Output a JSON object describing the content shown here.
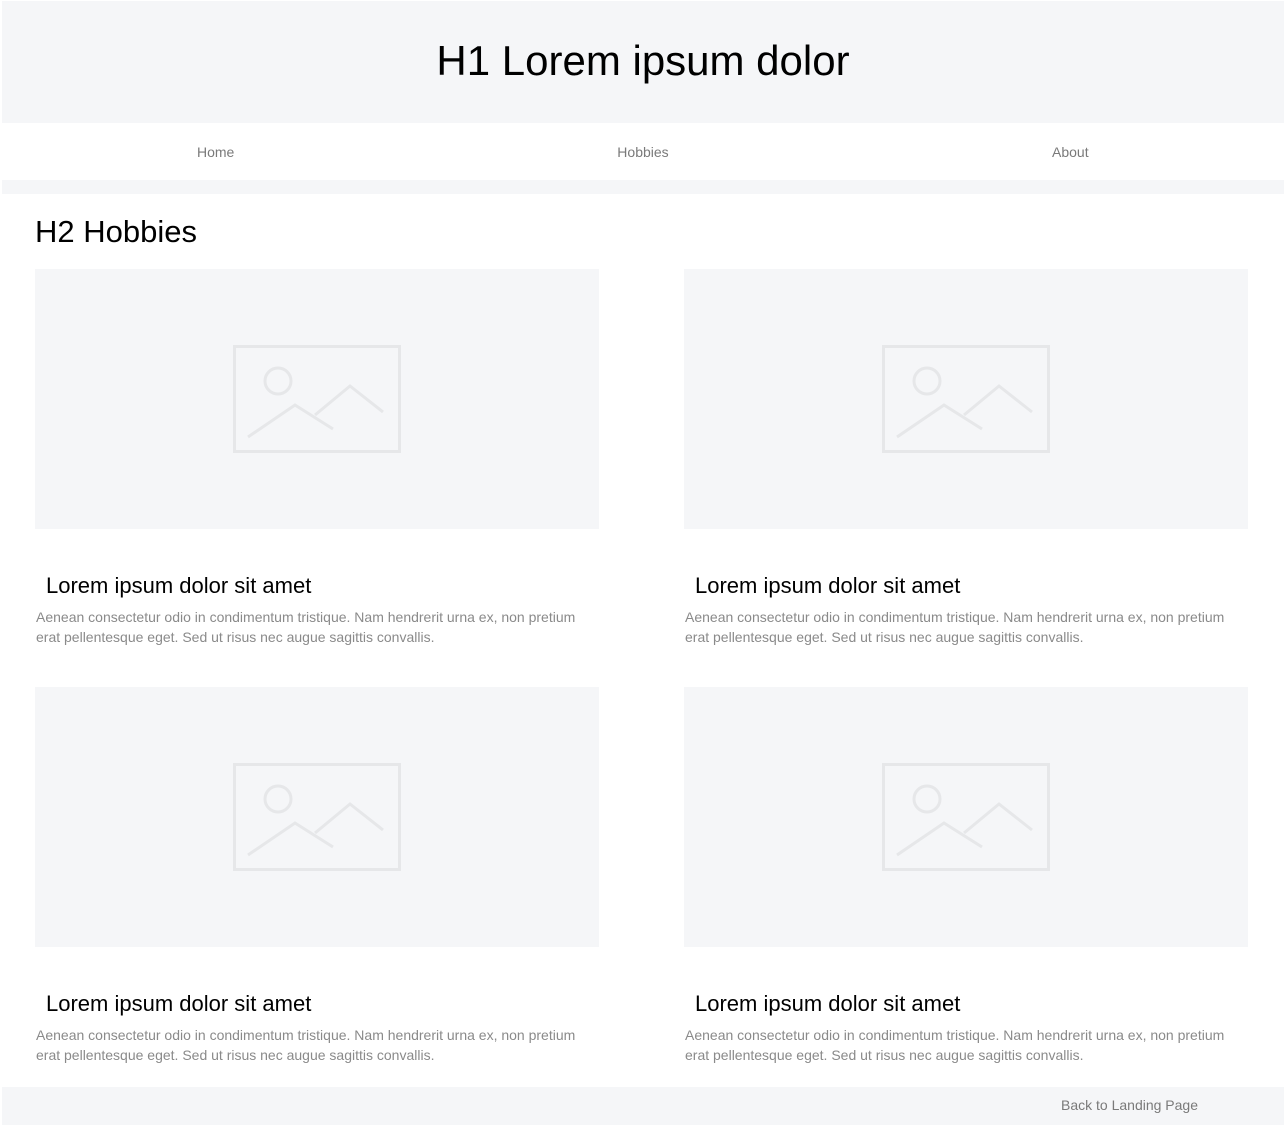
{
  "header": {
    "title": "H1 Lorem ipsum dolor"
  },
  "nav": {
    "items": [
      {
        "label": "Home"
      },
      {
        "label": "Hobbies"
      },
      {
        "label": "About"
      }
    ]
  },
  "section": {
    "heading": "H2 Hobbies"
  },
  "cards": [
    {
      "image_icon": "image-placeholder-icon",
      "title": "Lorem ipsum dolor sit amet",
      "description": "Aenean consectetur odio in condimentum tristique. Nam hendrerit urna ex, non pretium erat pellentesque eget. Sed ut risus nec augue sagittis convallis."
    },
    {
      "image_icon": "image-placeholder-icon",
      "title": "Lorem ipsum dolor sit amet",
      "description": "Aenean consectetur odio in condimentum tristique. Nam hendrerit urna ex, non pretium erat pellentesque eget. Sed ut risus nec augue sagittis convallis."
    },
    {
      "image_icon": "image-placeholder-icon",
      "title": "Lorem ipsum dolor sit amet",
      "description": "Aenean consectetur odio in condimentum tristique. Nam hendrerit urna ex, non pretium erat pellentesque eget. Sed ut risus nec augue sagittis convallis."
    },
    {
      "image_icon": "image-placeholder-icon",
      "title": "Lorem ipsum dolor sit amet",
      "description": "Aenean consectetur odio in condimentum tristique. Nam hendrerit urna ex, non pretium erat pellentesque eget. Sed ut risus nec augue sagittis convallis."
    }
  ],
  "footer": {
    "link_label": "Back to Landing Page"
  },
  "colors": {
    "panel_background": "#f5f6f8",
    "muted_text": "#8a8a8a",
    "nav_text": "#7a7a7a",
    "placeholder_stroke": "#e6e7e9"
  }
}
